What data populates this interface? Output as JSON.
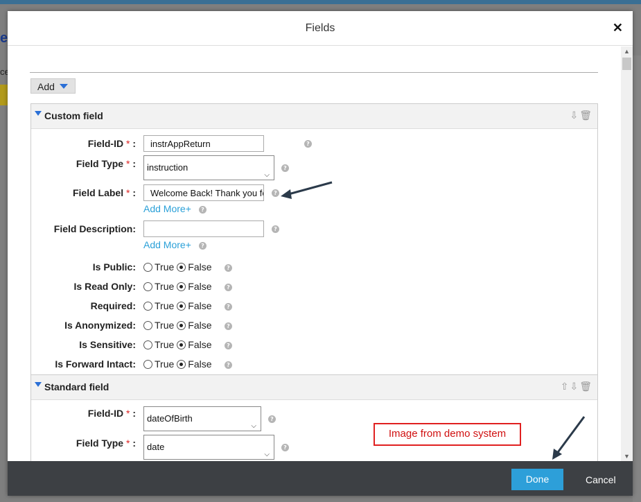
{
  "background": {
    "letter_e": "e",
    "letter_ce": "ce"
  },
  "dialog": {
    "title": "Fields",
    "close_glyph": "✕"
  },
  "toolbar": {
    "add_label": "Add"
  },
  "custom_field": {
    "title": "Custom field",
    "field_id": {
      "label": "Field-ID",
      "value": "instrAppReturn"
    },
    "field_type": {
      "label": "Field Type",
      "value": "instruction"
    },
    "field_label": {
      "label": "Field Label",
      "value": "Welcome Back! Thank you for"
    },
    "field_description": {
      "label": "Field Description:",
      "value": ""
    },
    "add_more": "Add More+",
    "radios": [
      {
        "label": "Is Public:",
        "selected": "False"
      },
      {
        "label": "Is Read Only:",
        "selected": "False"
      },
      {
        "label": "Required:",
        "selected": "False"
      },
      {
        "label": "Is Anonymized:",
        "selected": "False"
      },
      {
        "label": "Is Sensitive:",
        "selected": "False"
      },
      {
        "label": "Is Forward Intact:",
        "selected": "False"
      }
    ],
    "true_label": "True",
    "false_label": "False"
  },
  "standard_field": {
    "title": "Standard field",
    "field_id": {
      "label": "Field-ID",
      "value": "dateOfBirth"
    },
    "field_type": {
      "label": "Field Type",
      "value": "date"
    }
  },
  "annotation": {
    "text": "Image from demo system"
  },
  "footer": {
    "done_label": "Done",
    "cancel_label": "Cancel"
  },
  "colors": {
    "accent": "#2d9fd9",
    "link": "#2aa0d8",
    "required": "#d22222",
    "annotation": "#e02020",
    "footer": "#3d4044"
  },
  "icons": [
    "close-icon",
    "dropdown-caret-icon",
    "move-down-icon",
    "move-up-icon",
    "trash-icon",
    "help-icon",
    "chevron-down-icon",
    "arrow-annotation-icon"
  ]
}
